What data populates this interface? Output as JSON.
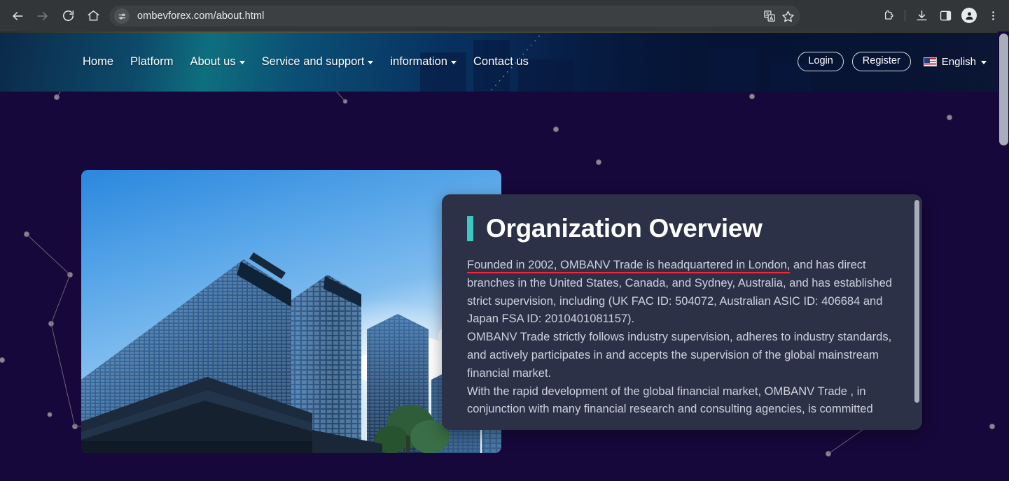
{
  "browser": {
    "url": "ombevforex.com/about.html",
    "back_label": "Back",
    "forward_label": "Forward",
    "reload_label": "Reload",
    "home_label": "Home",
    "site_info_label": "View site information",
    "translate_label": "Translate this page",
    "bookmark_label": "Bookmark this tab",
    "extensions_label": "Extensions",
    "downloads_label": "Downloads",
    "side_panel_label": "Side panel",
    "profile_label": "Profile",
    "menu_label": "Customize and control Chrome"
  },
  "site_header": {
    "nav": [
      {
        "label": "Home",
        "has_caret": false
      },
      {
        "label": "Platform",
        "has_caret": false
      },
      {
        "label": "About us",
        "has_caret": true
      },
      {
        "label": "Service and support",
        "has_caret": true
      },
      {
        "label": "information",
        "has_caret": true
      },
      {
        "label": "Contact us",
        "has_caret": false
      }
    ],
    "login_label": "Login",
    "register_label": "Register",
    "language_label": "English",
    "language_flag": "us-flag-icon"
  },
  "main": {
    "title": "Organization Overview",
    "accent_color": "#3ec9c0",
    "highlight_color": "#f8253a",
    "card_color": "#2c3148",
    "background_color": "#16083a",
    "paragraphs": [
      {
        "highlight": "Founded in 2002, OMBANV Trade is headquartered in London,",
        "rest": " and has direct branches in the United States, Canada, and Sydney, Australia, and has established strict supervision, including (UK FAC ID: 504072, Australian ASIC ID: 406684 and Japan FSA ID: 2010401081157)."
      },
      {
        "highlight": "",
        "rest": "OMBANV Trade strictly follows industry supervision, adheres to industry standards, and actively participates in and accepts the supervision of the global mainstream financial market."
      },
      {
        "highlight": "",
        "rest": "With the rapid development of the global financial market, OMBANV Trade , in conjunction with many financial research and consulting agencies, is committed"
      }
    ],
    "photo_alt": "office-skyscrapers-photo"
  }
}
